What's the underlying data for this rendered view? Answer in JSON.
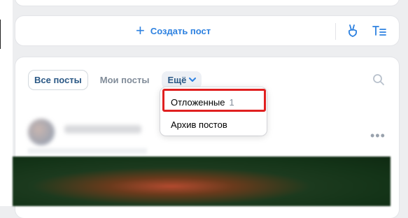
{
  "composer": {
    "create_label": "Создать пост"
  },
  "feed_tabs": {
    "all_posts": "Все посты",
    "my_posts": "Мои посты",
    "more": "Ещё"
  },
  "dropdown": {
    "items": [
      {
        "label": "Отложенные",
        "count": "1"
      },
      {
        "label": "Архив постов"
      }
    ]
  },
  "colors": {
    "accent": "#2d81e0",
    "highlight": "#e02020"
  }
}
